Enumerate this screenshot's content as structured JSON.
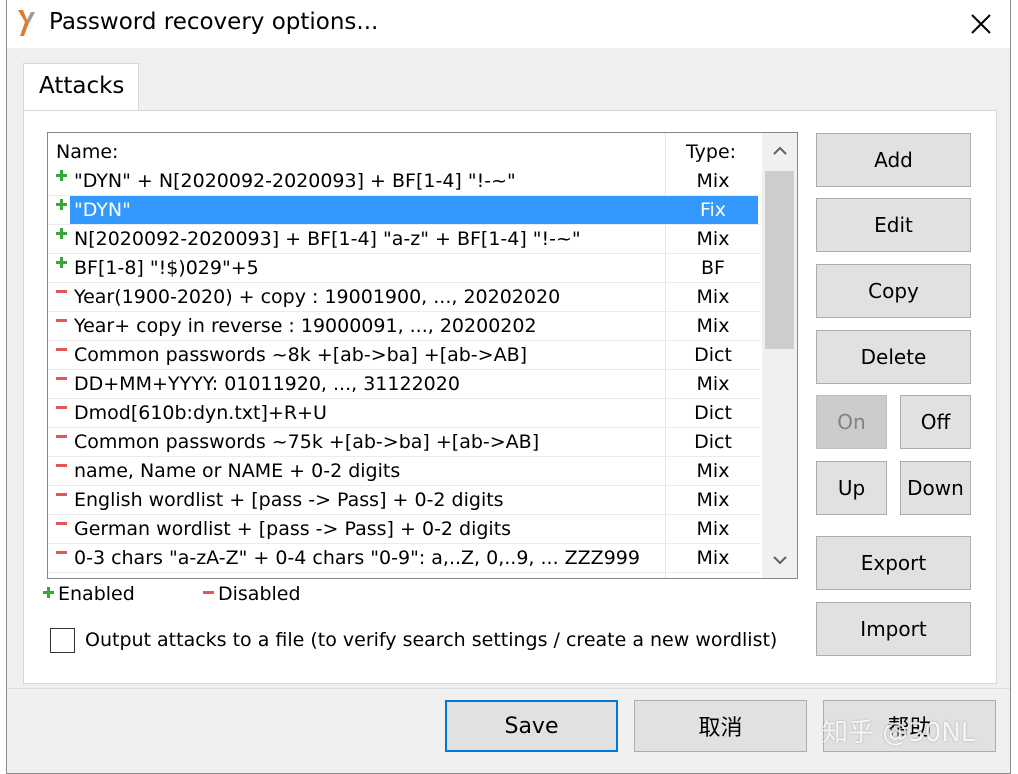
{
  "window": {
    "title": "Password recovery options..."
  },
  "tabs": [
    {
      "label": "Attacks"
    }
  ],
  "list": {
    "header_name": "Name:",
    "header_type": "Type:",
    "rows": [
      {
        "name": "\"DYN\" + N[2020092-2020093] + BF[1-4] \"!-~\"",
        "type": "Mix",
        "enabled": true
      },
      {
        "name": "\"DYN\"",
        "type": "Fix",
        "enabled": true,
        "selected": true
      },
      {
        "name": "N[2020092-2020093] + BF[1-4] \"a-z\" + BF[1-4] \"!-~\"",
        "type": "Mix",
        "enabled": true
      },
      {
        "name": "BF[1-8] \"!$)029\"+5",
        "type": "BF",
        "enabled": true
      },
      {
        "name": "Year(1900-2020) + copy : 19001900, ..., 20202020",
        "type": "Mix",
        "enabled": false
      },
      {
        "name": "Year+ copy in reverse : 19000091, ..., 20200202",
        "type": "Mix",
        "enabled": false
      },
      {
        "name": "Common passwords ~8k +[ab->ba] +[ab->AB]",
        "type": "Dict",
        "enabled": false
      },
      {
        "name": "DD+MM+YYYY: 01011920, ..., 31122020",
        "type": "Mix",
        "enabled": false
      },
      {
        "name": "Dmod[610b:dyn.txt]+R+U",
        "type": "Dict",
        "enabled": false
      },
      {
        "name": "Common passwords ~75k +[ab->ba] +[ab->AB]",
        "type": "Dict",
        "enabled": false
      },
      {
        "name": "name, Name or NAME + 0-2 digits",
        "type": "Mix",
        "enabled": false
      },
      {
        "name": "English wordlist + [pass -> Pass] + 0-2 digits",
        "type": "Mix",
        "enabled": false
      },
      {
        "name": "German wordlist + [pass -> Pass] + 0-2 digits",
        "type": "Mix",
        "enabled": false
      },
      {
        "name": "0-3 chars \"a-zA-Z\" + 0-4 chars \"0-9\": a,..Z, 0,..9, ... ZZZ999",
        "type": "Mix",
        "enabled": false
      },
      {
        "name": "",
        "type": "",
        "enabled": false
      }
    ]
  },
  "buttons": {
    "add": "Add",
    "edit": "Edit",
    "copy": "Copy",
    "delete": "Delete",
    "on": "On",
    "off": "Off",
    "up": "Up",
    "down": "Down",
    "export": "Export",
    "import": "Import"
  },
  "legend": {
    "enabled": "Enabled",
    "disabled": "Disabled"
  },
  "output_checkbox": {
    "label": "Output attacks to a file (to verify search settings / create a new wordlist)",
    "checked": false
  },
  "footer": {
    "save": "Save",
    "cancel": "取消",
    "help": "帮助"
  },
  "watermark": "知乎 @30NL",
  "colors": {
    "selection": "#3399ff",
    "enabled_icon": "#3aa63a",
    "disabled_icon": "#e05555"
  }
}
